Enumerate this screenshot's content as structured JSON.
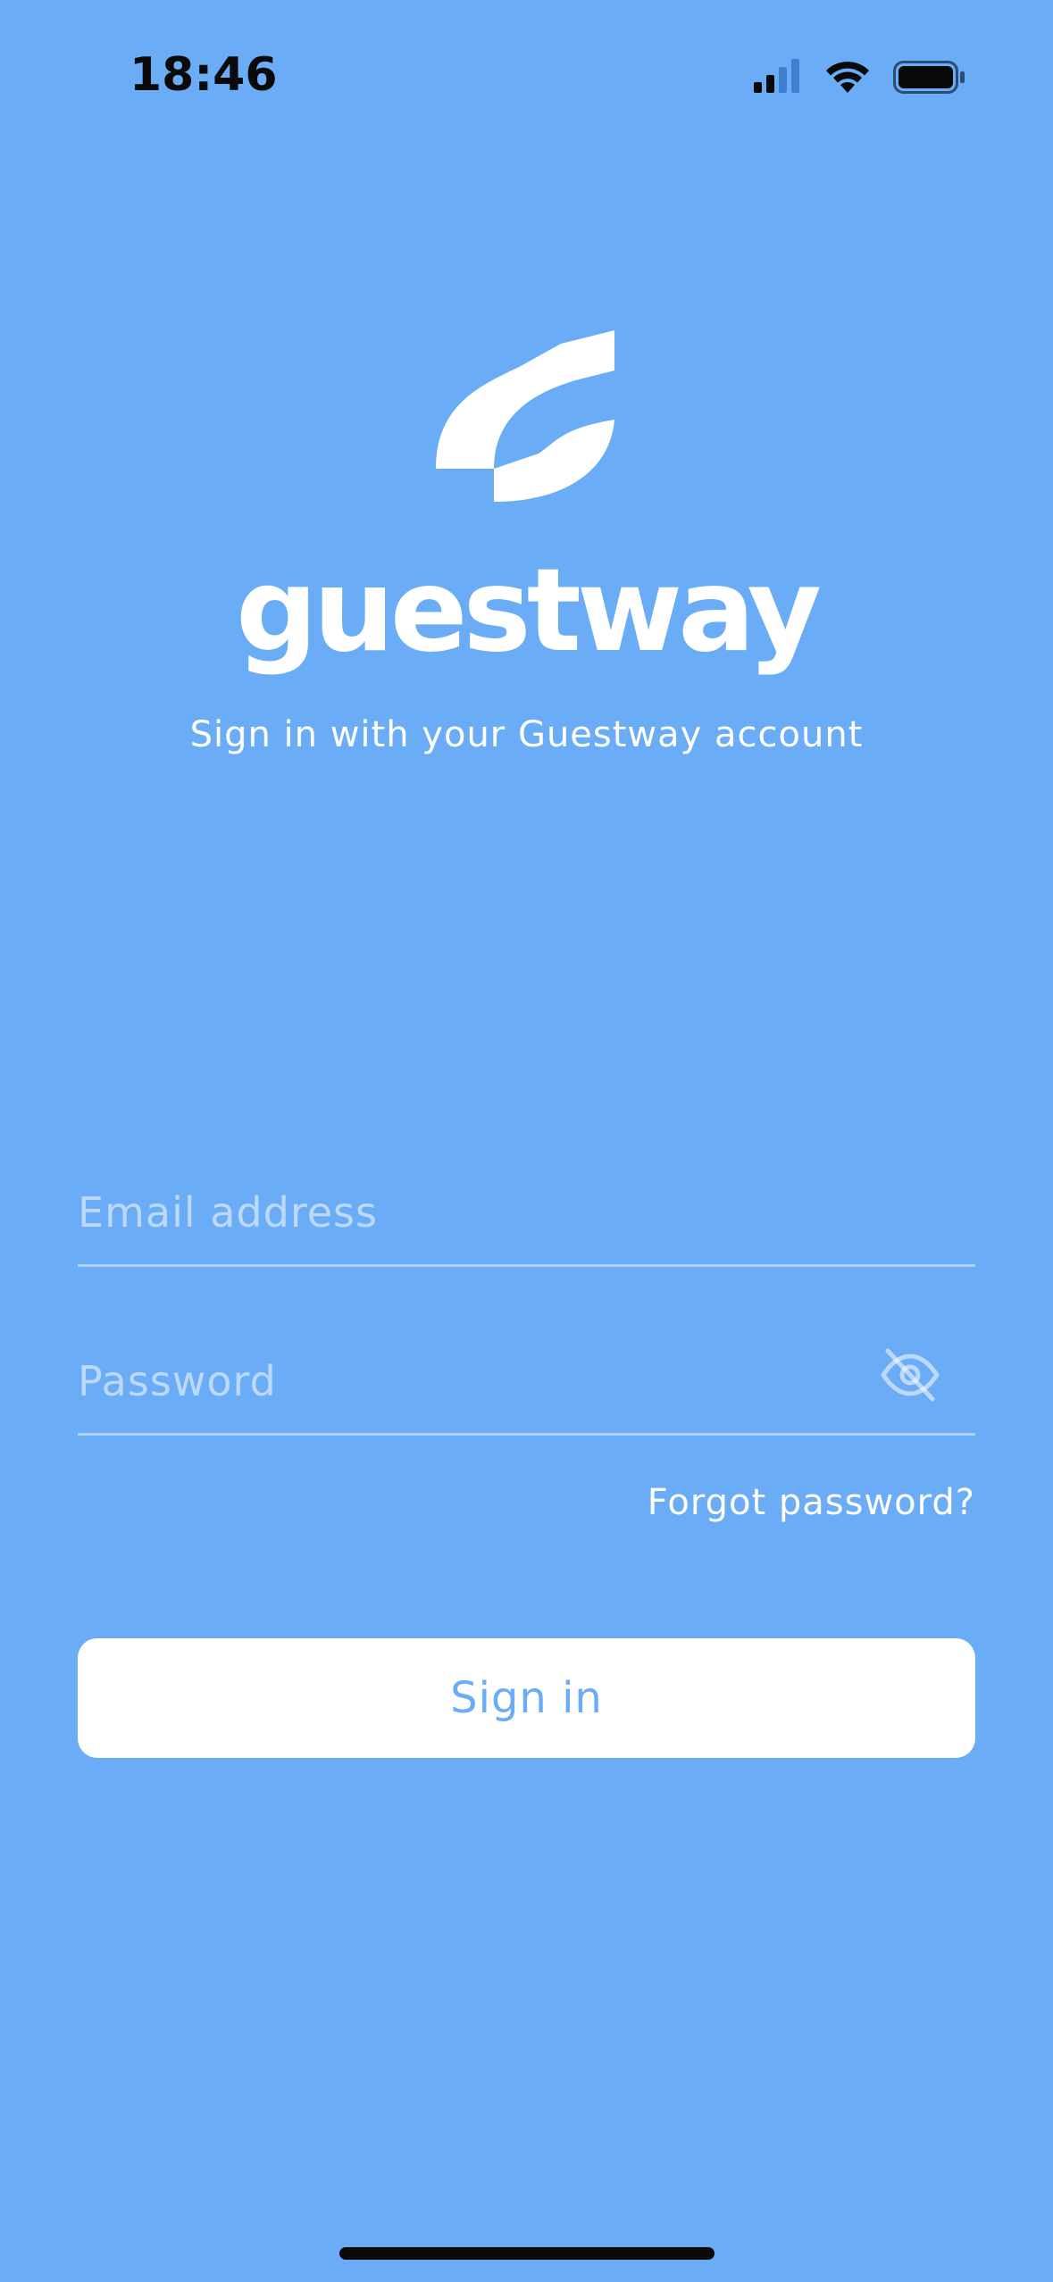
{
  "status_bar": {
    "time": "18:46",
    "icons": [
      "cellular-signal-icon",
      "wifi-icon",
      "battery-icon"
    ]
  },
  "brand": {
    "name": "guestway",
    "subtitle": "Sign in with your Guestway account"
  },
  "form": {
    "email_placeholder": "Email address",
    "email_value": "",
    "password_placeholder": "Password",
    "password_value": "",
    "forgot_label": "Forgot password?",
    "signin_label": "Sign in"
  },
  "colors": {
    "background": "#6aacf5",
    "button_bg": "#ffffff",
    "button_text": "#6aacf5",
    "text": "#ffffff"
  }
}
